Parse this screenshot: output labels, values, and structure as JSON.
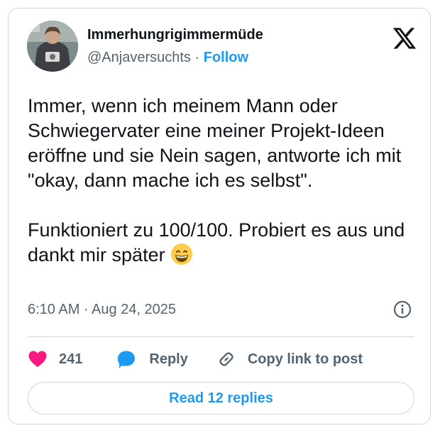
{
  "author": {
    "display_name": "Immerhungrigimmermüde",
    "handle": "@Anjaversuchts",
    "separator": "·",
    "follow_label": "Follow"
  },
  "tweet": {
    "text": "Immer, wenn ich meinem Mann oder Schwiegervater eine meiner Projekt-Ideen eröffne und sie Nein sagen, antworte ich mit \"okay, dann mache ich es selbst\".\n\nFunktioniert zu 100/100. Probiert es aus und dankt mir später ",
    "emoji": "grinning-face-with-smiling-eyes",
    "timestamp": "6:10 AM · Aug 24, 2025"
  },
  "actions": {
    "likes_count": "241",
    "reply_label": "Reply",
    "copy_link_label": "Copy link to post"
  },
  "read_replies_label": "Read 12 replies",
  "colors": {
    "accent": "#1d9bf0",
    "like": "#f91880",
    "text": "#0f1419",
    "muted": "#536471",
    "border": "#cfd9de"
  },
  "icons": [
    "x-logo-icon",
    "info-icon",
    "heart-icon",
    "reply-bubble-icon",
    "link-icon"
  ]
}
